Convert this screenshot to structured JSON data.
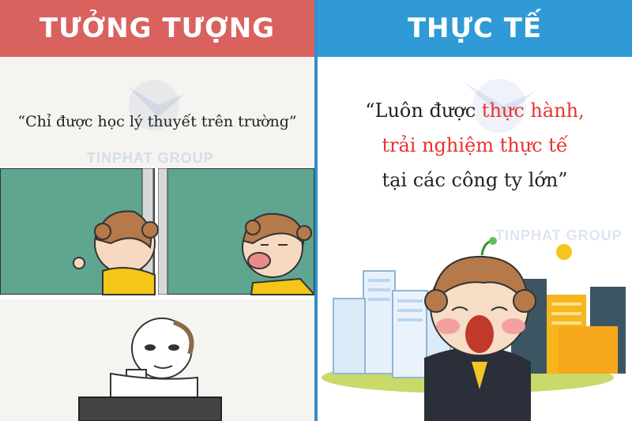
{
  "left": {
    "title": "TƯỞNG TƯỢNG",
    "quote": "“Chỉ được học lý thuyết trên trường”",
    "watermark": "TINPHAT GROUP"
  },
  "right": {
    "title": "THỰC TẾ",
    "quote_line1_prefix": "“Luôn được ",
    "quote_line1_highlight": "thực hành,",
    "quote_line2": "trải nghiệm thực tế",
    "quote_line3": "tại các công ty lớn”",
    "watermark": "TINPHAT GROUP"
  },
  "colors": {
    "left_header": "#d9625f",
    "right_header": "#2f9ad6",
    "highlight": "#e7332f",
    "board": "#5fa58f"
  }
}
